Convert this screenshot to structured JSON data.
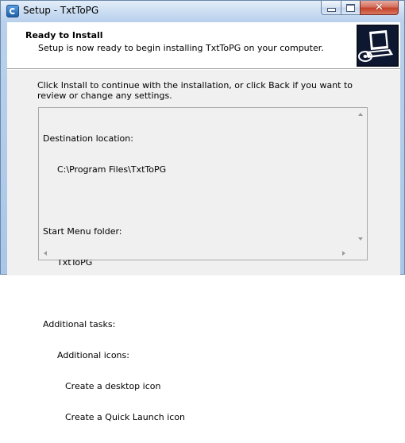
{
  "window": {
    "title": "Setup - TxtToPG",
    "icon": "setup-app-icon"
  },
  "caption_buttons": {
    "minimize_icon": "minimize-icon",
    "maximize_icon": "maximize-icon",
    "close_icon": "close-icon",
    "close_glyph": "✕"
  },
  "header": {
    "title": "Ready to Install",
    "subtitle": "Setup is now ready to begin installing TxtToPG on your computer.",
    "image_icon": "computer-install-icon"
  },
  "body": {
    "instruction": "Click Install to continue with the installation, or click Back if you want to review or change any settings."
  },
  "summary": {
    "destination_label": "Destination location:",
    "destination_value": "C:\\Program Files\\TxtToPG",
    "start_menu_label": "Start Menu folder:",
    "start_menu_value": "TxtToPG",
    "tasks_label": "Additional tasks:",
    "icons_label": "Additional icons:",
    "task_desktop": "Create a desktop icon",
    "task_quicklaunch": "Create a Quick Launch icon"
  },
  "colors": {
    "title_bar": "#c9dcf1",
    "close_button": "#c5412a",
    "panel_bg": "#f0f0f0",
    "header_bg": "#ffffff"
  }
}
